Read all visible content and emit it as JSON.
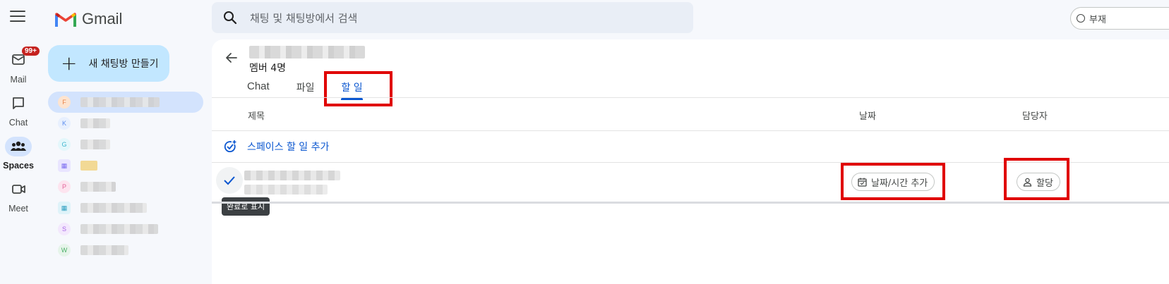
{
  "app": {
    "name": "Gmail"
  },
  "rail": {
    "items": [
      {
        "label": "Mail",
        "badge": "99+"
      },
      {
        "label": "Chat"
      },
      {
        "label": "Spaces"
      },
      {
        "label": "Meet"
      }
    ]
  },
  "compose": {
    "label": "새 채팅방 만들기"
  },
  "spaces": [
    {
      "initial": "F",
      "color": "#f4b183",
      "bg": "#fde4d0"
    },
    {
      "initial": "K",
      "color": "#8ab4f8",
      "bg": "#e8f0fe"
    },
    {
      "initial": "G",
      "color": "#78d9ec",
      "bg": "#e4f7fb"
    },
    {
      "initial": "",
      "color": "#9a8cf0",
      "bg": "#e9e5ff"
    },
    {
      "initial": "P",
      "color": "#f28bb8",
      "bg": "#fde4ef"
    },
    {
      "initial": "",
      "color": "#4fb3d0",
      "bg": "#dff3f9"
    },
    {
      "initial": "S",
      "color": "#c58af9",
      "bg": "#f3e8fd"
    },
    {
      "initial": "W",
      "color": "#81c995",
      "bg": "#e6f4ea"
    }
  ],
  "search": {
    "placeholder": "채팅 및 채팅방에서 검색"
  },
  "status": {
    "label": "부재"
  },
  "space": {
    "members": "멤버 4명",
    "tabs": [
      "Chat",
      "파일",
      "할 일"
    ],
    "active_tab": "할 일"
  },
  "tasks_table": {
    "headers": {
      "title": "제목",
      "date": "날짜",
      "assignee": "담당자"
    },
    "add_task_label": "스페이스 할 일 추가",
    "complete_tooltip": "완료로 표시",
    "date_chip": "날짜/시간 추가",
    "assign_chip": "할당"
  },
  "colors": {
    "accent": "#0b57d0",
    "highlight": "#e00000",
    "compose_bg": "#c2e7ff"
  }
}
